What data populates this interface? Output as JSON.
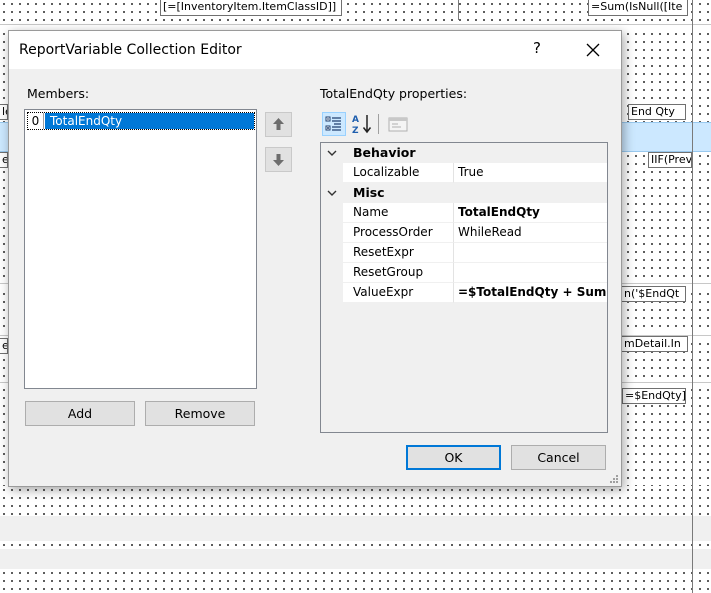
{
  "background": {
    "fields": {
      "inventory_class": "[=[InventoryItem.ItemClassID]]",
      "sum_isnull": "=Sum(IsNull([Ite",
      "end_qty_header": "End Qty",
      "iif_prev": "IIF(Prev.([I",
      "le_fragment": "le",
      "e_fragment": "e",
      "end_qt_expr": "n('$EndQt",
      "detail_in": "mDetail.In",
      "colon_fragment": "e:",
      "endqty_ref": "=$EndQty]"
    }
  },
  "dialog": {
    "title": "ReportVariable Collection Editor",
    "help_glyph": "?",
    "members_label": "Members:",
    "members": [
      {
        "index": "0",
        "name": "TotalEndQty",
        "selected": true
      }
    ],
    "add_label": "Add",
    "remove_label": "Remove",
    "properties_label": "TotalEndQty properties:",
    "ok_label": "OK",
    "cancel_label": "Cancel",
    "property_grid": {
      "categories": [
        {
          "name": "Behavior",
          "properties": [
            {
              "name": "Localizable",
              "value": "True",
              "bold": false
            }
          ]
        },
        {
          "name": "Misc",
          "properties": [
            {
              "name": "Name",
              "value": "TotalEndQty",
              "bold": true
            },
            {
              "name": "ProcessOrder",
              "value": "WhileRead",
              "bold": false
            },
            {
              "name": "ResetExpr",
              "value": "",
              "bold": false
            },
            {
              "name": "ResetGroup",
              "value": "",
              "bold": false
            },
            {
              "name": "ValueExpr",
              "value": "=$TotalEndQty + Sum",
              "bold": true
            }
          ]
        }
      ]
    }
  },
  "colors": {
    "selection": "#0078d7",
    "highlight_band": "#cce8ff",
    "dialog_face": "#f0f0f0",
    "default_button_border": "#0078d7"
  }
}
